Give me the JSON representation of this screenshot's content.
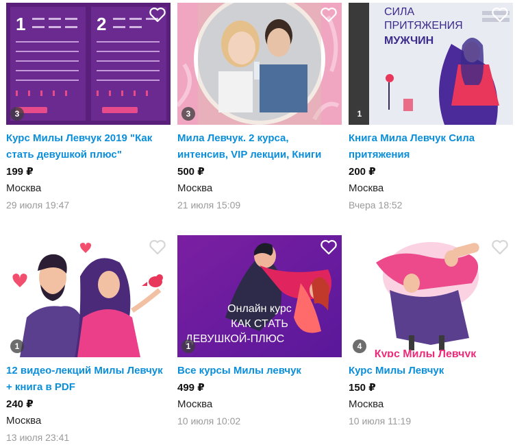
{
  "listings": [
    {
      "title": "Курс Милы Левчук 2019 \"Как стать девушкой плюс\"",
      "price": "199 ₽",
      "city": "Москва",
      "date": "29 июля 19:47",
      "photo_count": "3",
      "image": "purple-course-slides",
      "favorite": "heart-icon-white"
    },
    {
      "title": "Мила Левчук. 2 курса, интенсив, VIP лекции, Книги",
      "price": "500 ₽",
      "city": "Москва",
      "date": "21 июля 15:09",
      "photo_count": "3",
      "image": "couple-photo-pink-circle",
      "favorite": "heart-icon-white"
    },
    {
      "title": "Книга Мила Левчук Сила притяжения",
      "price": "200 ₽",
      "city": "Москва",
      "date": "Вчера 18:52",
      "photo_count": "1",
      "image": "book-cover-pink-dress",
      "cover_text": [
        "СИЛА",
        "ПРИТЯЖЕНИЯ",
        "МУЖЧИН"
      ],
      "favorite": "heart-icon-white"
    },
    {
      "title": "12 видео-лекций Милы Левчук + книга в PDF",
      "price": "240 ₽",
      "city": "Москва",
      "date": "13 июля 23:41",
      "photo_count": "1",
      "image": "illustration-couple-bird",
      "favorite": "heart-icon-gray"
    },
    {
      "title": "Все курсы Милы левчук",
      "price": "499 ₽",
      "city": "Москва",
      "date": "10 июля 10:02",
      "photo_count": "1",
      "image": "course-banner-dancing",
      "banner_text": [
        "Онлайн курс",
        "КАК СТАТЬ",
        "ДЕВУШКОЙ-ПЛЮС"
      ],
      "favorite": "heart-icon-white"
    },
    {
      "title": "Курс Милы Левчук",
      "price": "150 ₽",
      "city": "Москва",
      "date": "10 июля 11:19",
      "photo_count": "4",
      "image": "illustration-man-carrying-woman",
      "banner_text": [
        "Курс Милы Левчук"
      ],
      "favorite": "heart-icon-gray"
    }
  ],
  "colors": {
    "link": "#0a8ed9",
    "date": "#9a9a9a",
    "accent_pink": "#e83e8c",
    "accent_purple": "#6a1b9a"
  }
}
